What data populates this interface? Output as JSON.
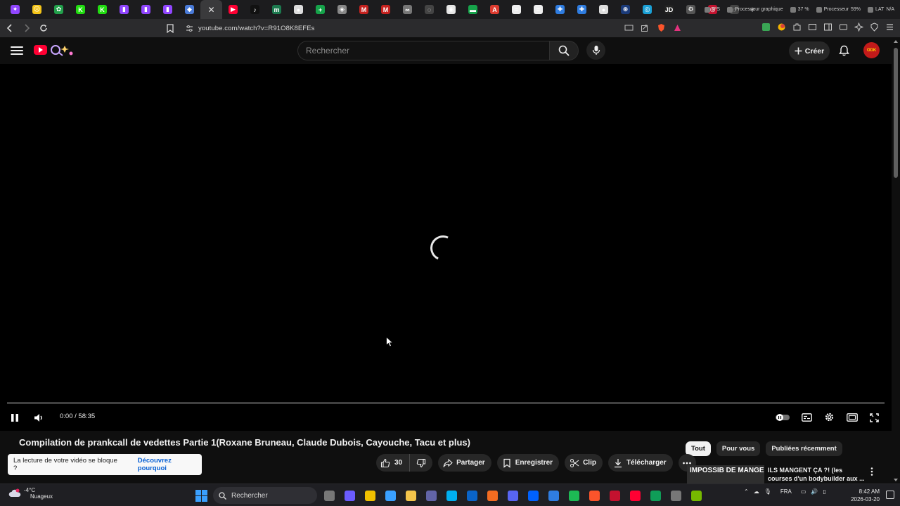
{
  "browser": {
    "tabs": [
      {
        "icon": "twitch-purple-icon",
        "color": "#9146ff",
        "glyph": "✦",
        "active": false
      },
      {
        "icon": "sad-face-icon",
        "color": "#f5c518",
        "glyph": "☹",
        "active": false
      },
      {
        "icon": "green-leaf-icon",
        "color": "#22a04b",
        "glyph": "✿",
        "active": false
      },
      {
        "icon": "kick-icon",
        "color": "#2d1",
        "glyph": "K",
        "active": false
      },
      {
        "icon": "kick-icon",
        "color": "#2d1",
        "glyph": "K",
        "active": false
      },
      {
        "icon": "twitch-icon",
        "color": "#9146ff",
        "glyph": "▮",
        "active": false
      },
      {
        "icon": "twitch-icon",
        "color": "#9146ff",
        "glyph": "▮",
        "active": false
      },
      {
        "icon": "twitch-icon",
        "color": "#9146ff",
        "glyph": "▮",
        "active": false
      },
      {
        "icon": "stack-icon",
        "color": "#4a7bd8",
        "glyph": "◆",
        "active": false
      },
      {
        "icon": "close-icon",
        "color": "#3a3a3c",
        "glyph": "✕",
        "active": true
      },
      {
        "icon": "youtube-icon",
        "color": "#ff0033",
        "glyph": "▶",
        "active": false
      },
      {
        "icon": "tiktok-icon",
        "color": "#111",
        "glyph": "♪",
        "active": false
      },
      {
        "icon": "m-circle-icon",
        "color": "#1c7a4f",
        "glyph": "m",
        "active": false
      },
      {
        "icon": "circle-icon",
        "color": "#ddd",
        "glyph": "●",
        "active": false
      },
      {
        "icon": "green-plus-icon",
        "color": "#16a34a",
        "glyph": "+",
        "active": false
      },
      {
        "icon": "shield-icon",
        "color": "#888",
        "glyph": "◈",
        "active": false
      },
      {
        "icon": "gmail-icon",
        "color": "#c5221f",
        "glyph": "M",
        "active": false
      },
      {
        "icon": "gmail-icon",
        "color": "#c5221f",
        "glyph": "M",
        "active": false
      },
      {
        "icon": "link-icon",
        "color": "#777",
        "glyph": "∞",
        "active": false
      },
      {
        "icon": "loading-icon",
        "color": "#444",
        "glyph": "◌",
        "active": false
      },
      {
        "icon": "white-circle-icon",
        "color": "#e5e5e5",
        "glyph": "◉",
        "active": false
      },
      {
        "icon": "green-bar-icon",
        "color": "#16a34a",
        "glyph": "▬",
        "active": false
      },
      {
        "icon": "red-a-icon",
        "color": "#dd3b2f",
        "glyph": "A",
        "active": false
      },
      {
        "icon": "doc-icon",
        "color": "#eee",
        "glyph": "≡",
        "active": false
      },
      {
        "icon": "doc-icon",
        "color": "#eee",
        "glyph": "≡",
        "active": false
      },
      {
        "icon": "blue-plus-icon",
        "color": "#2f7de1",
        "glyph": "✚",
        "active": false
      },
      {
        "icon": "blue-plus-icon",
        "color": "#2f7de1",
        "glyph": "✚",
        "active": false
      },
      {
        "icon": "gray-circle-icon",
        "color": "#ddd",
        "glyph": "●",
        "active": false
      },
      {
        "icon": "logo-icon",
        "color": "#1b3b7a",
        "glyph": "⊛",
        "active": false
      },
      {
        "icon": "cyan-circle-icon",
        "color": "#1aa0d6",
        "glyph": "◎",
        "active": false
      },
      {
        "icon": "jd-icon",
        "color": "#222",
        "glyph": "JD",
        "active": false
      },
      {
        "icon": "gear-circle-icon",
        "color": "#555",
        "glyph": "⚙",
        "active": false
      },
      {
        "icon": "red-ring-icon",
        "color": "#c4122f",
        "glyph": "◎",
        "active": false
      },
      {
        "icon": "loading-icon",
        "color": "#444",
        "glyph": "◌",
        "active": false
      }
    ],
    "new_tab_glyph": "+",
    "sysmon": [
      {
        "label": "IPS",
        "value": ""
      },
      {
        "label": "Processeur graphique",
        "value": ""
      },
      {
        "label": "",
        "value": "37 %"
      },
      {
        "label": "Processeur",
        "value": "59%"
      },
      {
        "label": "LAT",
        "value": "N/A"
      }
    ],
    "url": "youtube.com/watch?v=R91O8K8EFEs"
  },
  "youtube": {
    "search_placeholder": "Rechercher",
    "create_label": "Créer",
    "avatar_text": "ODK",
    "player": {
      "time_current": "0:00",
      "time_total": "58:35",
      "time_display": "0:00 / 58:35",
      "progress_fraction": 0.0
    },
    "video_title": "Compilation de prankcall de vedettes Partie 1(Roxane Bruneau, Claude Dubois, Cayouche, Tacu et plus)",
    "chips": [
      "Tout",
      "Pour vous",
      "Publiées récemment"
    ],
    "notice": {
      "text": "La lecture de votre vidéo se bloque ?",
      "link": "Découvrez pourquoi"
    },
    "actions": {
      "like_count": "30",
      "share": "Partager",
      "save": "Enregistrer",
      "clip": "Clip",
      "download": "Télécharger"
    },
    "recommendation": {
      "thumb_text": "IMPOSSIB DE MANGE",
      "title": "ILS MANGENT ÇA ?! (les courses d'un bodybuilder aux ..."
    }
  },
  "taskbar": {
    "weather_temp": "-4°C",
    "weather_desc": "Nuageux",
    "search_label": "Rechercher",
    "language": "FRA",
    "time": "8:42 AM",
    "date": "2026-03-20",
    "apps": [
      {
        "icon": "task-view-icon",
        "color": "#777"
      },
      {
        "icon": "copilot-icon",
        "color": "#6b5cff"
      },
      {
        "icon": "store-icon",
        "color": "#f0c000"
      },
      {
        "icon": "notepad-icon",
        "color": "#3aa0ff"
      },
      {
        "icon": "file-explorer-icon",
        "color": "#f3c44b"
      },
      {
        "icon": "teams-icon",
        "color": "#6264a7"
      },
      {
        "icon": "skype-icon",
        "color": "#00aff0"
      },
      {
        "icon": "outlook-icon",
        "color": "#0a64c8"
      },
      {
        "icon": "headset-icon",
        "color": "#f36c21"
      },
      {
        "icon": "discord-icon",
        "color": "#5865f2"
      },
      {
        "icon": "dropbox-icon",
        "color": "#0061fe"
      },
      {
        "icon": "phone-link-icon",
        "color": "#2f7de1"
      },
      {
        "icon": "spotify-icon",
        "color": "#1db954"
      },
      {
        "icon": "brave-icon",
        "color": "#fb542b"
      },
      {
        "icon": "opera-icon",
        "color": "#c4122f"
      },
      {
        "icon": "youtube-app-icon",
        "color": "#ff0033"
      },
      {
        "icon": "edge-icon",
        "color": "#0f9d58"
      },
      {
        "icon": "chrome-icon",
        "color": "#777"
      },
      {
        "icon": "nvidia-icon",
        "color": "#76b900"
      }
    ]
  },
  "colors": {
    "yt_red": "#ff0033",
    "link_blue": "#065fd4",
    "bg": "#0f0f0f"
  }
}
